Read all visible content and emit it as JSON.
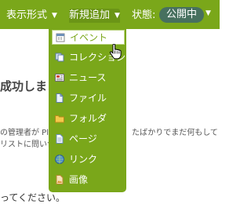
{
  "menubar": {
    "view_label": "表示形式",
    "add_label": "新規追加",
    "state_label": "状態:",
    "state_value": "公開中"
  },
  "background": {
    "heading": "成功しました",
    "line1_left": "の管理者が Pl",
    "line1_right": "たばかりでまだ何もして",
    "line2_left": "リストに問い合",
    "bottom": "ってください。"
  },
  "dropdown": {
    "items": [
      {
        "label": "イベント",
        "icon": "event-icon"
      },
      {
        "label": "コレクション",
        "icon": "collection-icon"
      },
      {
        "label": "ニュース",
        "icon": "news-icon"
      },
      {
        "label": "ファイル",
        "icon": "file-icon"
      },
      {
        "label": "フォルダ",
        "icon": "folder-icon"
      },
      {
        "label": "ページ",
        "icon": "page-icon"
      },
      {
        "label": "リンク",
        "icon": "link-icon"
      },
      {
        "label": "画像",
        "icon": "image-icon"
      }
    ],
    "hovered_index": 0
  },
  "colors": {
    "menubar": "#7aa71a",
    "badge": "#47705f",
    "text_light": "#ffffff"
  }
}
